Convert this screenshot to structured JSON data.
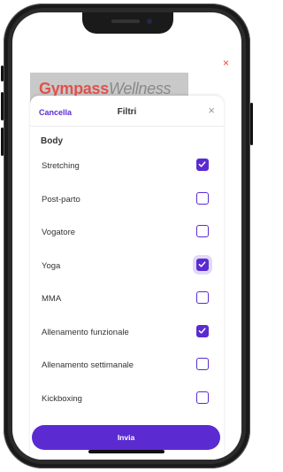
{
  "background": {
    "close_glyph": "×",
    "brand_bold": "Gympass",
    "brand_light": "Wellness"
  },
  "sheet": {
    "cancel_label": "Cancella",
    "title": "Filtri",
    "close_glyph": "×",
    "section_title": "Body",
    "submit_label": "Invia"
  },
  "filters": [
    {
      "label": "Stretching",
      "checked": true
    },
    {
      "label": "Post-parto",
      "checked": false
    },
    {
      "label": "Vogatore",
      "checked": false
    },
    {
      "label": "Yoga",
      "checked": true
    },
    {
      "label": "MMA",
      "checked": false
    },
    {
      "label": "Allenamento funzionale",
      "checked": true
    },
    {
      "label": "Allenamento settimanale",
      "checked": false
    },
    {
      "label": "Kickboxing",
      "checked": false
    }
  ],
  "colors": {
    "accent": "#5b2bd1",
    "brand_red": "#e0524c",
    "close_red": "#e8453c"
  }
}
